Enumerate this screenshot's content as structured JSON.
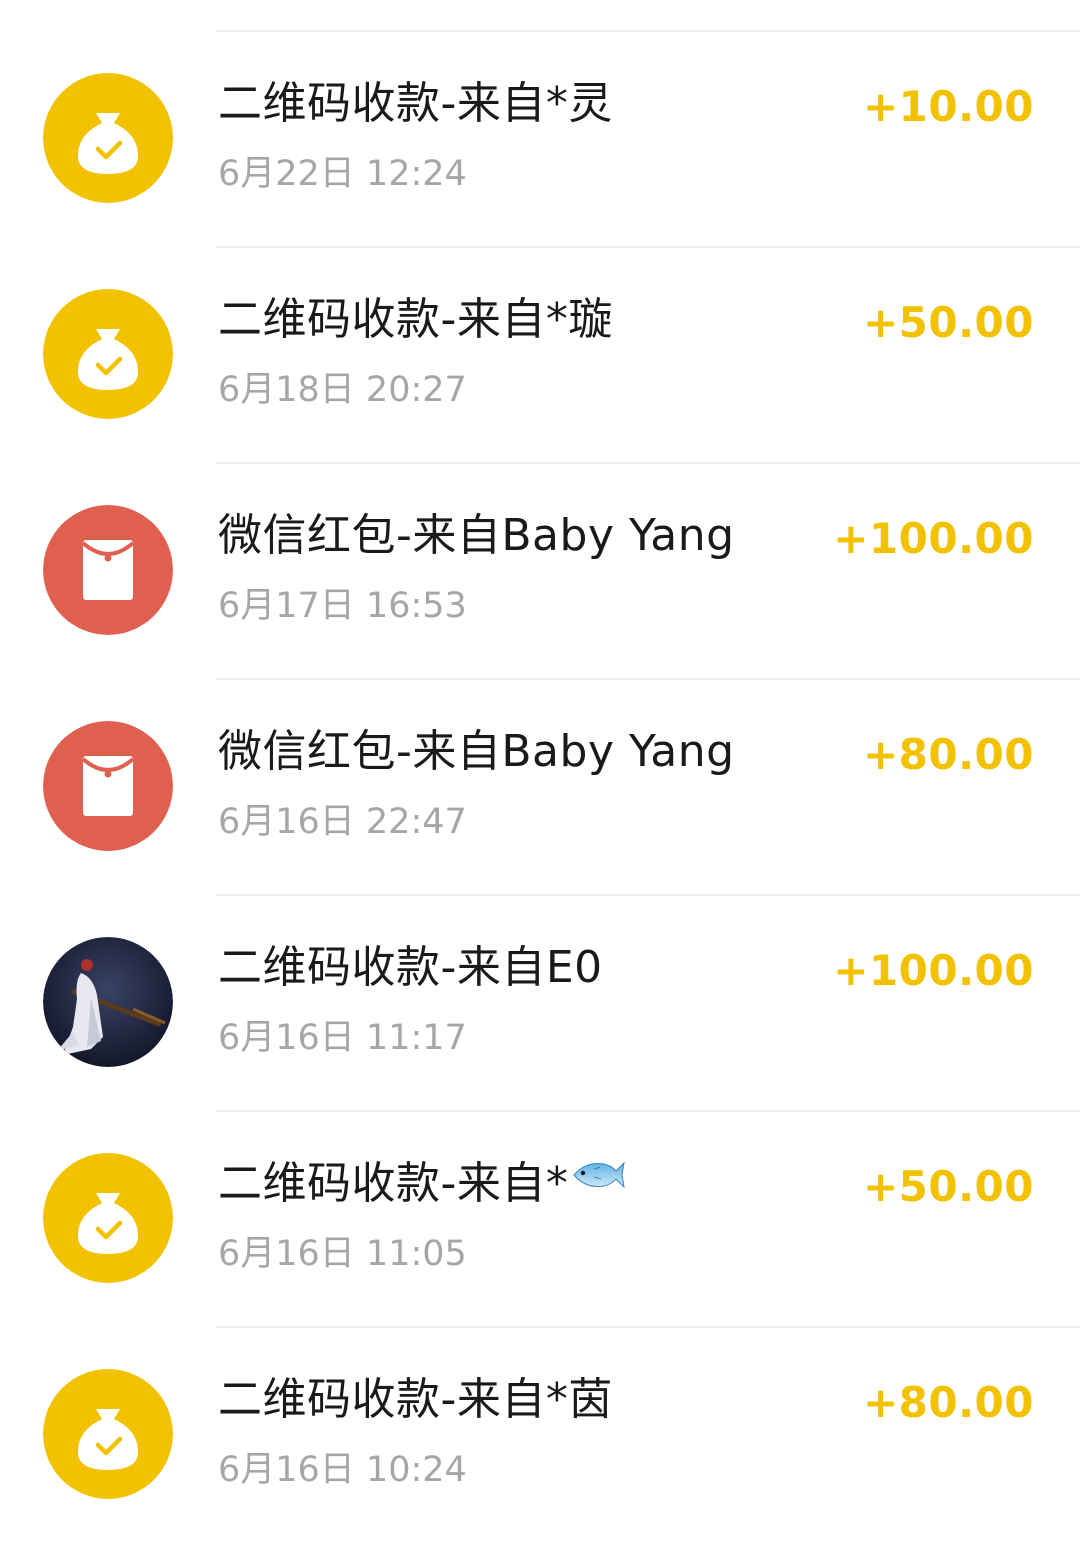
{
  "colors": {
    "amount": "#f2c200",
    "money_bag_bg": "#f2c200",
    "red_packet_bg": "#e0604f",
    "title": "#1a1a1a",
    "time": "#a6a6a6",
    "divider": "#ececec"
  },
  "transactions": [
    {
      "icon": "money-bag-icon",
      "title": "二维码收款-来自*灵",
      "time": "6月22日 12:24",
      "amount": "+10.00"
    },
    {
      "icon": "money-bag-icon",
      "title": "二维码收款-来自*璇",
      "time": "6月18日 20:27",
      "amount": "+50.00"
    },
    {
      "icon": "red-packet-icon",
      "title": "微信红包-来自Baby Yang",
      "time": "6月17日 16:53",
      "amount": "+100.00"
    },
    {
      "icon": "red-packet-icon",
      "title": "微信红包-来自Baby Yang",
      "time": "6月16日 22:47",
      "amount": "+80.00"
    },
    {
      "icon": "user-avatar",
      "title": "二维码收款-来自E0",
      "time": "6月16日 11:17",
      "amount": "+100.00"
    },
    {
      "icon": "money-bag-icon",
      "title": "二维码收款-来自*",
      "title_emoji": "fish-icon",
      "time": "6月16日 11:05",
      "amount": "+50.00"
    },
    {
      "icon": "money-bag-icon",
      "title": "二维码收款-来自*茵",
      "time": "6月16日 10:24",
      "amount": "+80.00"
    }
  ]
}
